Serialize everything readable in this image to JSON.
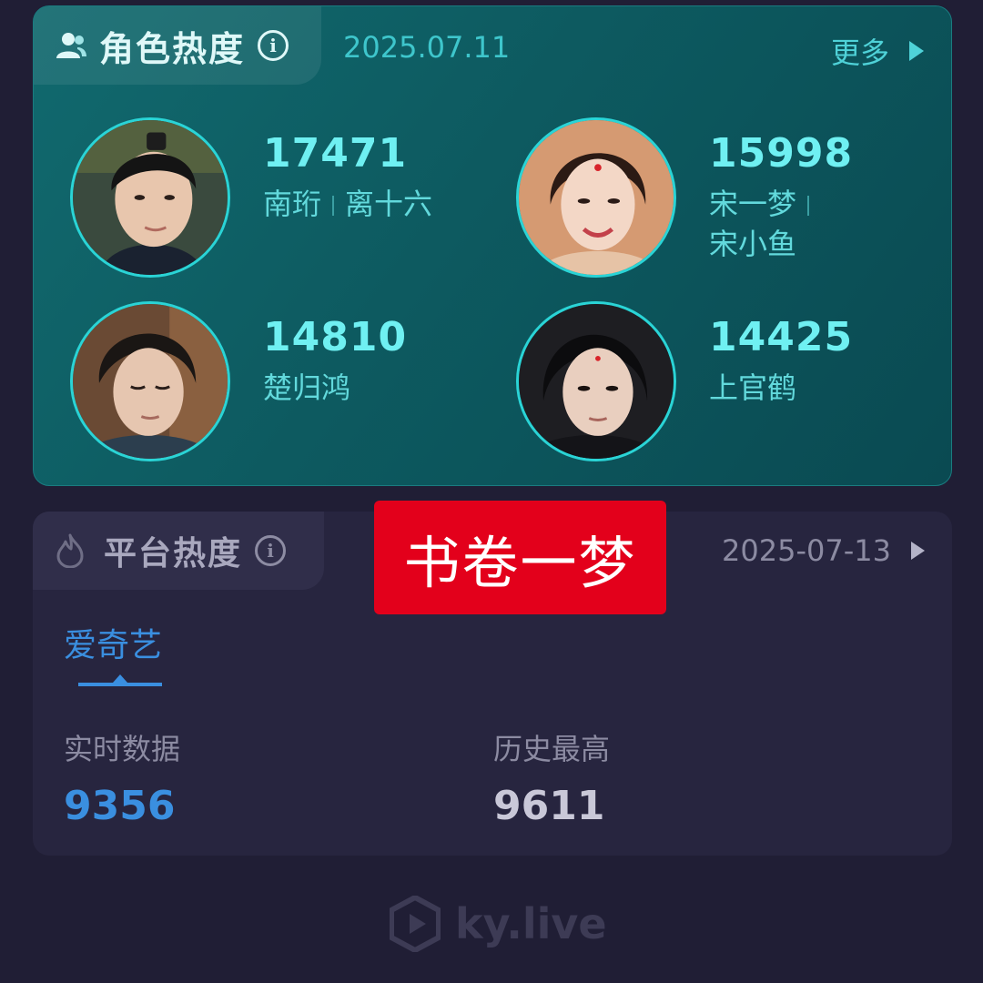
{
  "role_heat": {
    "title": "角色热度",
    "date": "2025.07.11",
    "more_label": "更多",
    "icon": "person-icon",
    "roles": [
      {
        "score": "17471",
        "names": [
          "南珩",
          "离十六"
        ]
      },
      {
        "score": "15998",
        "names": [
          "宋一梦",
          "宋小鱼"
        ]
      },
      {
        "score": "14810",
        "names": [
          "楚归鸿"
        ]
      },
      {
        "score": "14425",
        "names": [
          "上官鹤"
        ]
      }
    ]
  },
  "platform_heat": {
    "title": "平台热度",
    "date": "2025-07-13",
    "icon": "fire-icon",
    "active_platform": "爱奇艺",
    "realtime_label": "实时数据",
    "realtime_value": "9356",
    "history_label": "历史最高",
    "history_value": "9611"
  },
  "banner": {
    "text": "书卷一梦"
  },
  "watermark": {
    "text": "ky.live"
  },
  "colors": {
    "background": "#201e35",
    "role_card": "#0d5a60",
    "accent_teal": "#6ff0f2",
    "accent_blue": "#3a8fe0",
    "banner_red": "#e3001b"
  }
}
